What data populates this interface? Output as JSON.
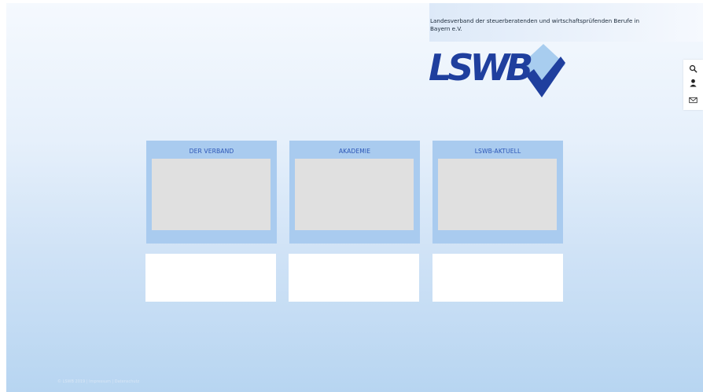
{
  "header": {
    "tagline": "Landesverband der steuerberatenden und wirtschaftsprüfenden Berufe in Bayern e.V.",
    "logo_text": "LSWB",
    "colors": {
      "logo_blue": "#1f3f9e",
      "logo_diamond": "#9fc6ec",
      "logo_check": "#1f3f9e"
    }
  },
  "side_toolbar": {
    "icons": [
      "search-icon",
      "user-icon",
      "mail-icon"
    ]
  },
  "cards": [
    {
      "title": "DER VERBAND"
    },
    {
      "title": "AKADEMIE"
    },
    {
      "title": "LSWB-AKTUELL"
    }
  ],
  "footer": {
    "text": "© LSWB 2019 | Impressum | Datenschutz"
  },
  "colors": {
    "card_background": "#a9cbef",
    "card_title": "#2c56b6",
    "image_placeholder": "#e0e0e0"
  }
}
